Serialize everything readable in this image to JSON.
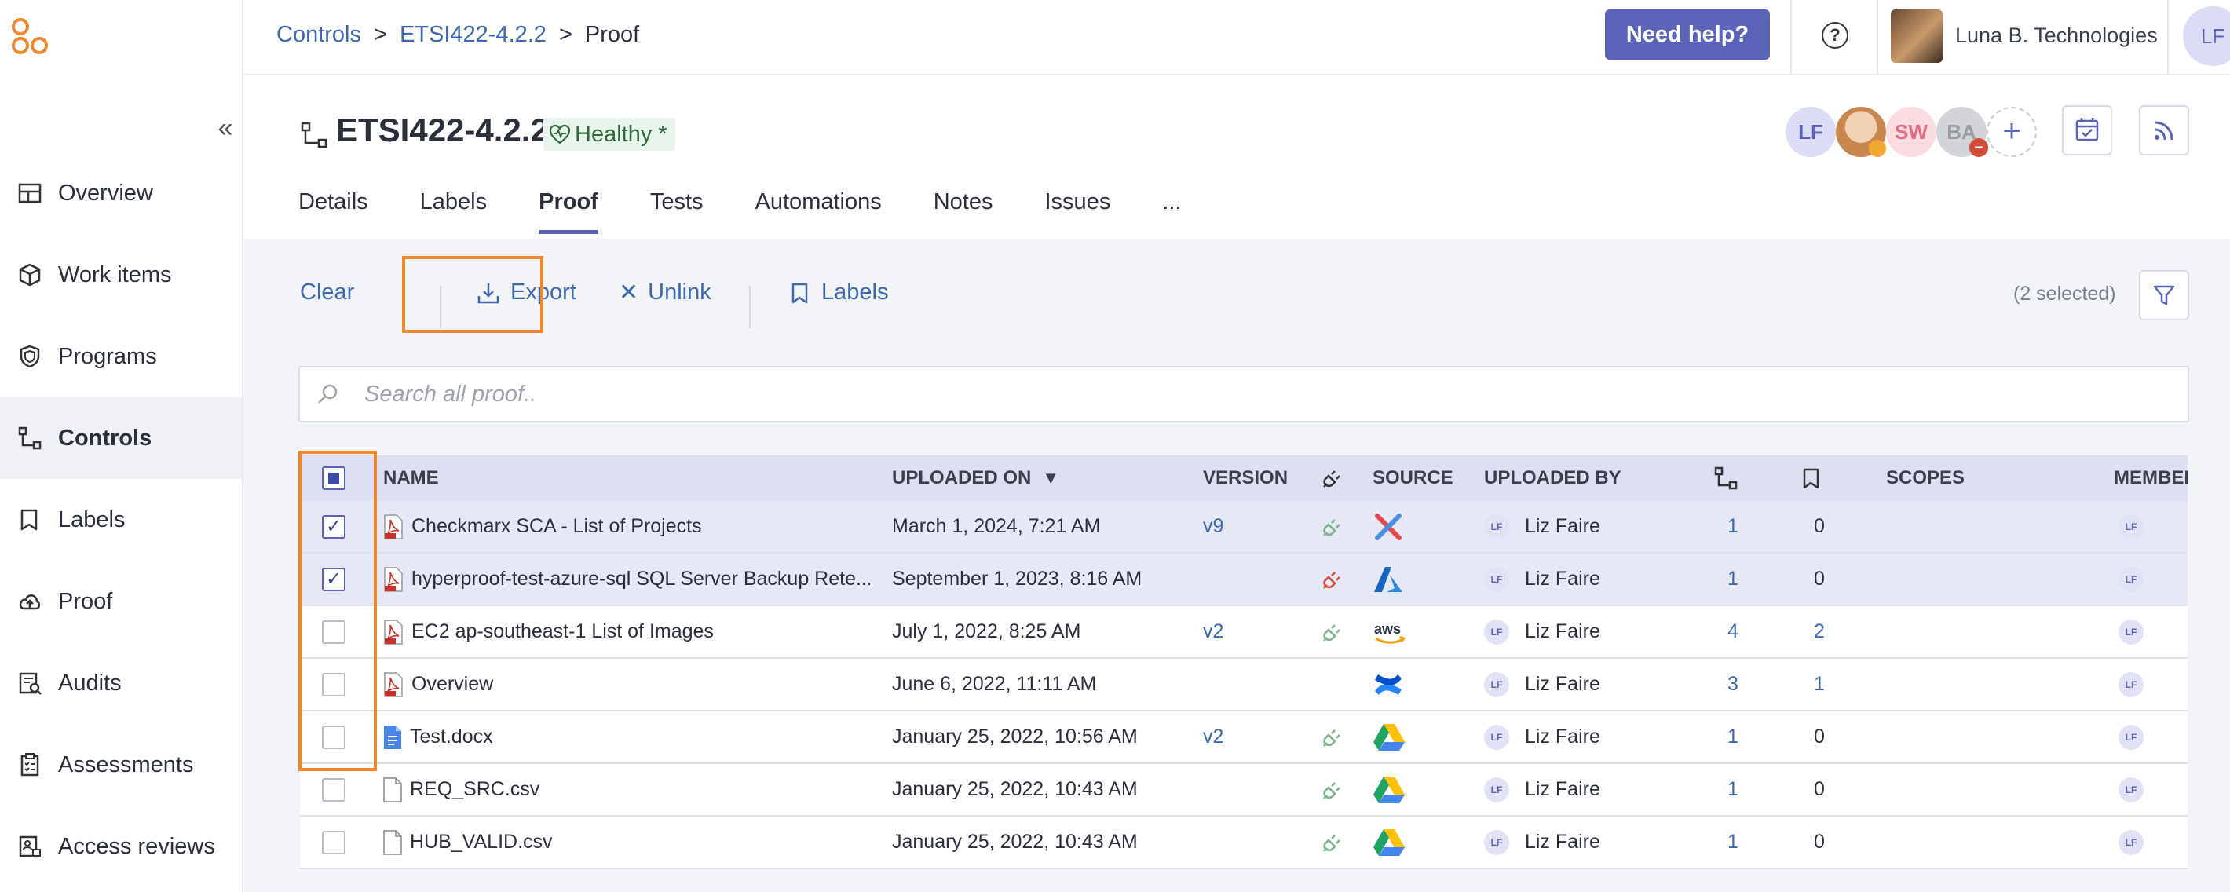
{
  "breadcrumb": {
    "root": "Controls",
    "parent": "ETSI422-4.2.2",
    "current": "Proof",
    "separator": ">"
  },
  "topbar": {
    "help_label": "Need help?",
    "org_name": "Luna B. Technologies",
    "user_initials": "LF"
  },
  "sidebar": {
    "items": [
      {
        "label": "Overview",
        "icon": "layout-icon"
      },
      {
        "label": "Work items",
        "icon": "box-icon"
      },
      {
        "label": "Programs",
        "icon": "shield-icon"
      },
      {
        "label": "Controls",
        "icon": "control-icon"
      },
      {
        "label": "Labels",
        "icon": "label-icon"
      },
      {
        "label": "Proof",
        "icon": "cloud-upload-icon"
      },
      {
        "label": "Audits",
        "icon": "audit-icon"
      },
      {
        "label": "Assessments",
        "icon": "clipboard-icon"
      },
      {
        "label": "Access reviews",
        "icon": "access-review-icon"
      }
    ],
    "active": "Controls"
  },
  "header": {
    "title": "ETSI422-4.2.2",
    "status": "Healthy *",
    "members": [
      {
        "initials": "LF",
        "bg": "#dcdcf5",
        "fg": "#5b63b8"
      },
      {
        "initials": "",
        "bg": "#e8c9a8",
        "fg": "#000000"
      },
      {
        "initials": "SW",
        "bg": "#fadbe0",
        "fg": "#e36b85"
      },
      {
        "initials": "BA",
        "bg": "#d3d4d8",
        "fg": "#9a9ca3"
      }
    ],
    "tabs": [
      "Details",
      "Labels",
      "Proof",
      "Tests",
      "Automations",
      "Notes",
      "Issues",
      "..."
    ],
    "active_tab": "Proof"
  },
  "toolbar": {
    "clear": "Clear",
    "export": "Export",
    "unlink": "Unlink",
    "labels": "Labels",
    "selected_count": "(2 selected)"
  },
  "search": {
    "placeholder": "Search all proof.."
  },
  "table": {
    "columns": {
      "name": "NAME",
      "uploaded_on": "UPLOADED ON",
      "version": "VERSION",
      "source": "SOURCE",
      "uploaded_by": "UPLOADED BY",
      "scopes": "SCOPES",
      "members": "MEMBEI"
    },
    "rows": [
      {
        "selected": true,
        "type": "pdf",
        "name": "Checkmarx SCA - List of Projects",
        "uploaded_on": "March 1, 2024, 7:21 AM",
        "version": "v9",
        "plug": "connected",
        "source": "checkmarx",
        "uploaded_by": "Liz Faire",
        "controls": "1",
        "labels": "0",
        "labels_link": false,
        "member": "LF"
      },
      {
        "selected": true,
        "type": "pdf",
        "name": "hyperproof-test-azure-sql SQL Server Backup Rete...",
        "uploaded_on": "September 1, 2023, 8:16 AM",
        "version": "",
        "plug": "disconnected",
        "source": "azure",
        "uploaded_by": "Liz Faire",
        "controls": "1",
        "labels": "0",
        "labels_link": false,
        "member": "LF"
      },
      {
        "selected": false,
        "type": "pdf",
        "name": "EC2 ap-southeast-1 List of Images",
        "uploaded_on": "July 1, 2022, 8:25 AM",
        "version": "v2",
        "plug": "connected",
        "source": "aws",
        "uploaded_by": "Liz Faire",
        "controls": "4",
        "labels": "2",
        "labels_link": true,
        "member": "LF"
      },
      {
        "selected": false,
        "type": "pdf",
        "name": "Overview",
        "uploaded_on": "June 6, 2022, 11:11 AM",
        "version": "",
        "plug": "none",
        "source": "confluence",
        "uploaded_by": "Liz Faire",
        "controls": "3",
        "labels": "1",
        "labels_link": true,
        "member": "LF"
      },
      {
        "selected": false,
        "type": "doc",
        "name": "Test.docx",
        "uploaded_on": "January 25, 2022, 10:56 AM",
        "version": "v2",
        "plug": "connected",
        "source": "google-drive",
        "uploaded_by": "Liz Faire",
        "controls": "1",
        "labels": "0",
        "labels_link": false,
        "member": "LF"
      },
      {
        "selected": false,
        "type": "file",
        "name": "REQ_SRC.csv",
        "uploaded_on": "January 25, 2022, 10:43 AM",
        "version": "",
        "plug": "connected",
        "source": "google-drive",
        "uploaded_by": "Liz Faire",
        "controls": "1",
        "labels": "0",
        "labels_link": false,
        "member": "LF"
      },
      {
        "selected": false,
        "type": "file",
        "name": "HUB_VALID.csv",
        "uploaded_on": "January 25, 2022, 10:43 AM",
        "version": "",
        "plug": "connected",
        "source": "google-drive",
        "uploaded_by": "Liz Faire",
        "controls": "1",
        "labels": "0",
        "labels_link": false,
        "member": "LF"
      }
    ]
  },
  "colors": {
    "accent": "#5b63b8",
    "link": "#3d68b0",
    "highlight": "#f0872b",
    "plug_connected": "#7bb58b",
    "plug_disconnected": "#d64a3a"
  }
}
